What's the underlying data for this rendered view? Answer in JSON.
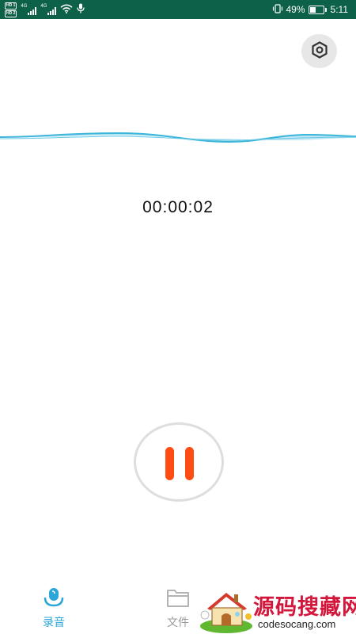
{
  "status_bar": {
    "hd_badges": [
      "HD 1",
      "HD 2"
    ],
    "network_labels": [
      "4G",
      "4G"
    ],
    "battery_percent": "49%",
    "battery_level": 0.49,
    "time": "5:11",
    "icons": [
      "wifi-icon",
      "microphone-icon",
      "vibrate-icon",
      "battery-icon"
    ]
  },
  "toolbar": {
    "settings_icon": "settings-icon"
  },
  "waveform": {
    "color": "#3bb5da",
    "fill": "#bde7f5"
  },
  "recorder": {
    "elapsed": "00:00:02",
    "control_icon": "pause-icon",
    "accent": "#ff4c12"
  },
  "bottom_nav": {
    "active_color": "#2aa6d8",
    "items": [
      {
        "label": "录音",
        "icon": "microphone-icon",
        "active": true
      },
      {
        "label": "文件",
        "icon": "folder-icon",
        "active": false
      }
    ]
  },
  "watermark": {
    "title": "源码搜藏网",
    "url": "codesocang.com",
    "logo": "house-logo"
  }
}
